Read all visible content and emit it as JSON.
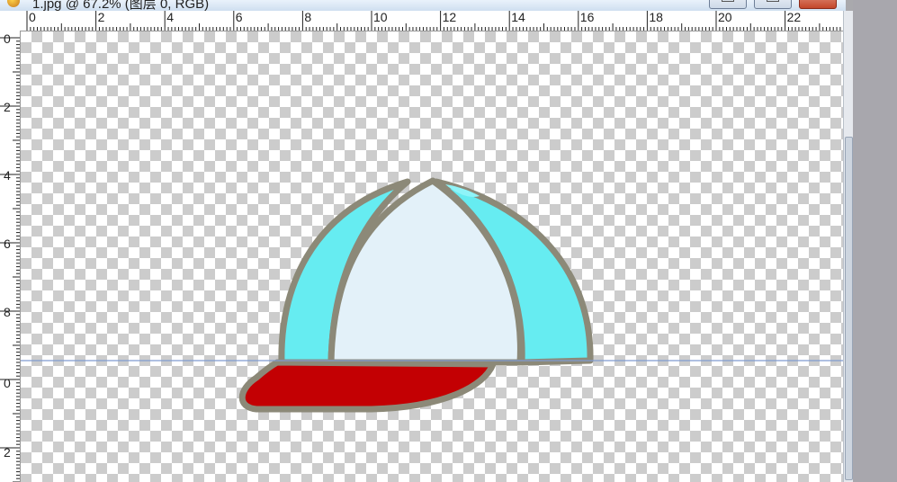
{
  "window": {
    "title": "1.jpg @ 67.2% (图层 0, RGB)",
    "buttons": [
      "minimize",
      "maximize",
      "close"
    ]
  },
  "rulers": {
    "top_labels": [
      "0",
      "2",
      "4",
      "6",
      "8",
      "10",
      "12",
      "14",
      "16",
      "18",
      "20",
      "22"
    ],
    "left_labels": [
      "0",
      "2",
      "4",
      "6",
      "8",
      "0",
      "2"
    ]
  },
  "canvas": {
    "background": "transparency-checkerboard",
    "guide_color": "#7f9bd0",
    "image_subject": "cap",
    "colors": {
      "crown_center": "#e3f1f9",
      "crown_side_panels": "#66ecf1",
      "brim": "#c30003",
      "outline": "#8c8978"
    }
  }
}
